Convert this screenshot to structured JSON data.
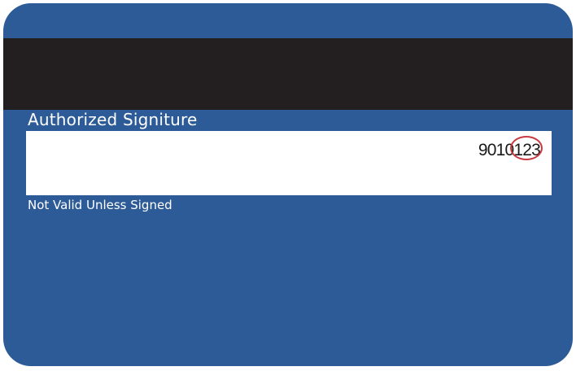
{
  "card": {
    "signature_label": "Authorized Signiture",
    "account_digits": "9010",
    "cvv": "123",
    "footer_text": "Not Valid Unless Signed"
  },
  "colors": {
    "card_blue": "#2d5b98",
    "stripe_black": "#231f20",
    "panel_white": "#ffffff",
    "cvv_highlight_red": "#c8393f"
  }
}
